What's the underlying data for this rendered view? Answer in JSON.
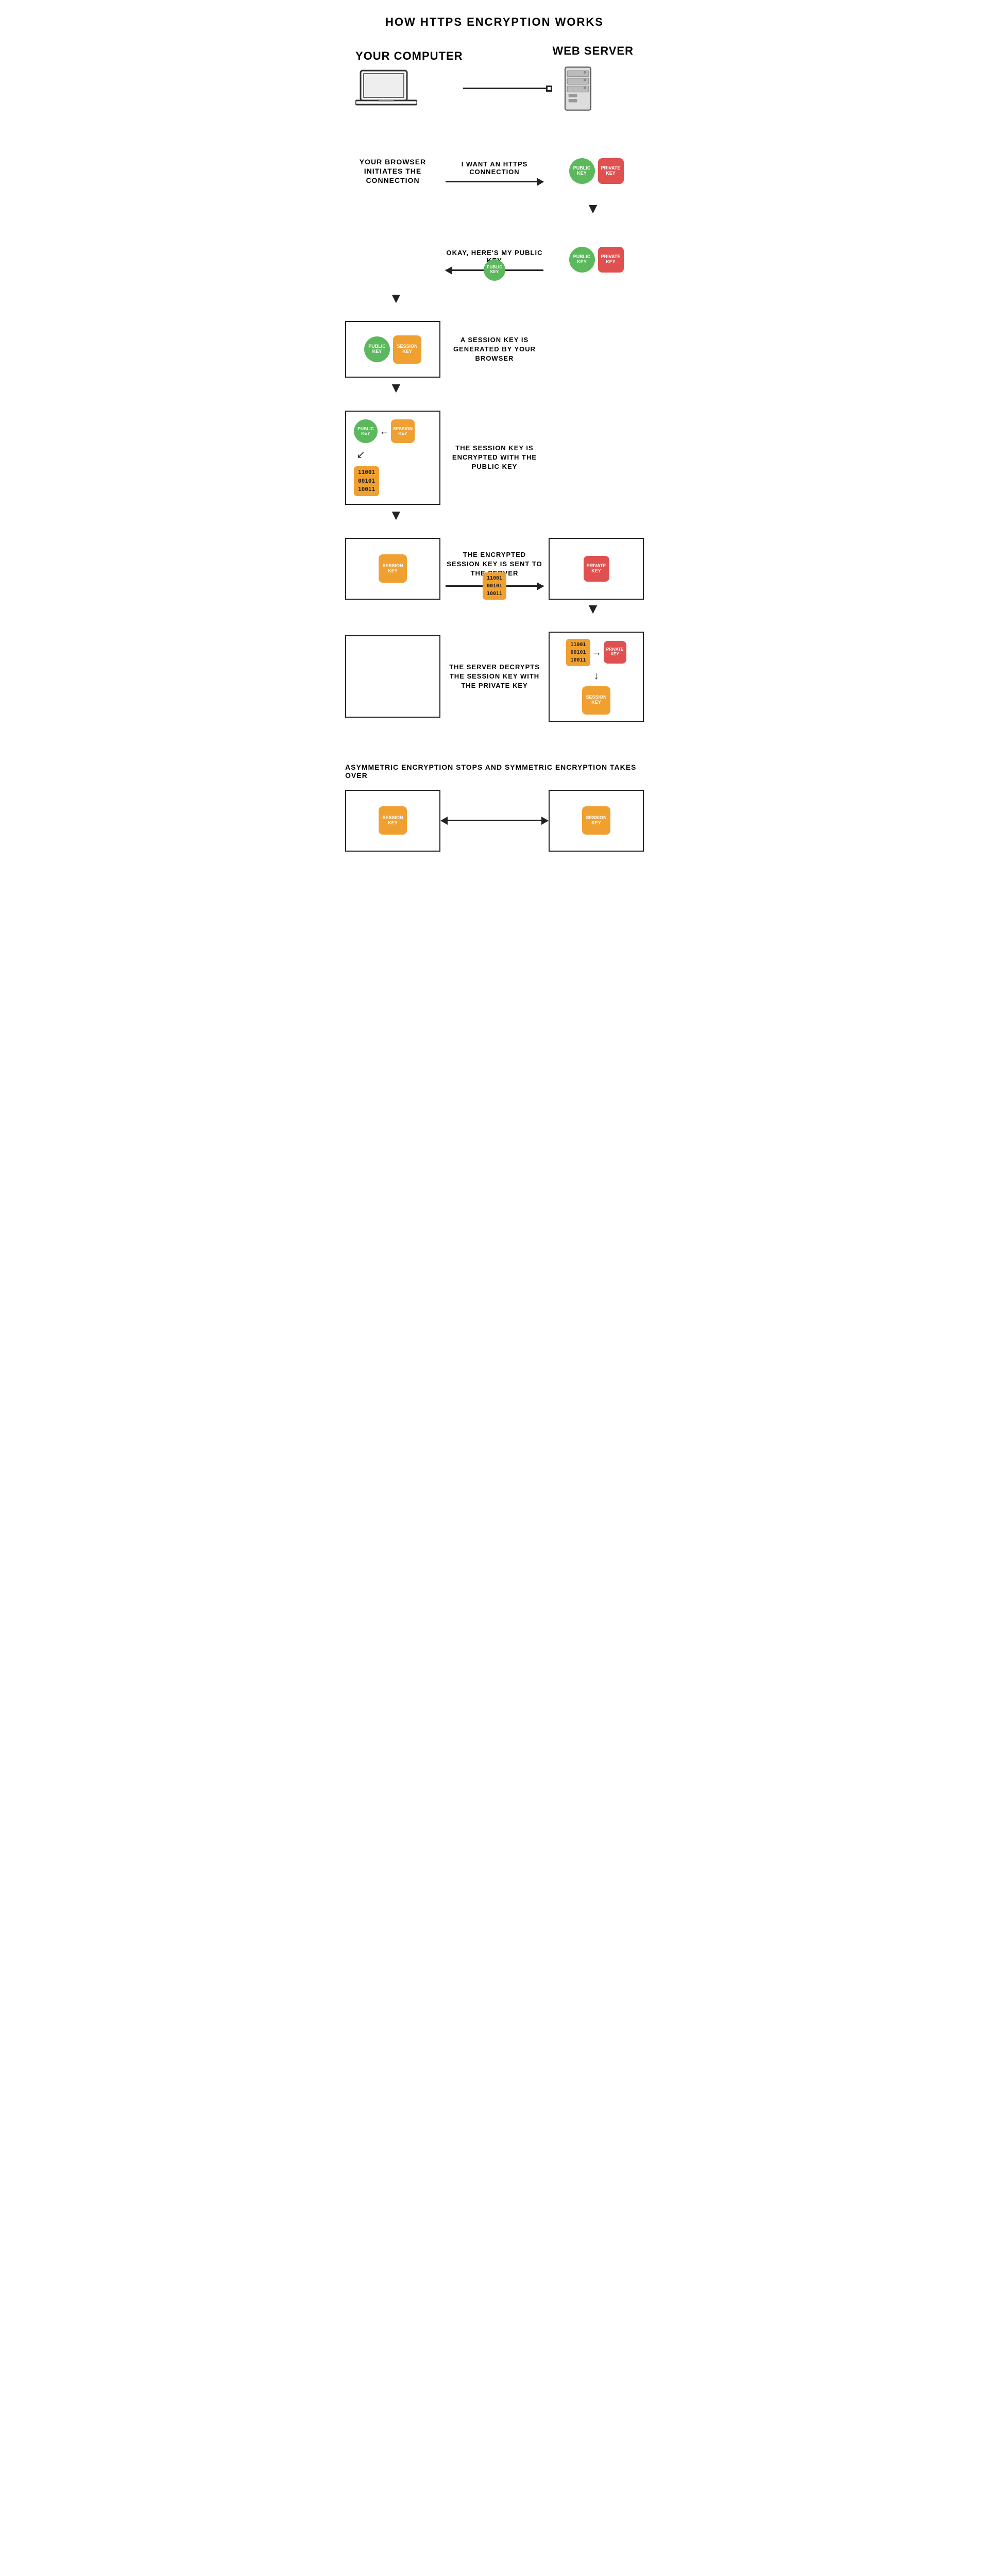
{
  "title": "HOW HTTPS ENCRYPTION WORKS",
  "computer_label": "YOUR COMPUTER",
  "server_label": "WEB SERVER",
  "step1": {
    "left_text": "YOUR BROWSER INITIATES THE CONNECTION",
    "arrow_label": "I WANT AN HTTPS CONNECTION"
  },
  "step2": {
    "arrow_label": "OKAY, HERE'S MY PUBLIC KEY"
  },
  "step3": {
    "label": "A SESSION KEY IS GENERATED BY YOUR BROWSER"
  },
  "step4": {
    "label": "THE SESSION KEY IS ENCRYPTED WITH THE PUBLIC KEY",
    "binary": "11001\n00101\n10011"
  },
  "step5": {
    "label": "THE ENCRYPTED SESSION KEY IS SENT TO THE SERVER",
    "binary": "11001\n00101\n10011"
  },
  "step6": {
    "label": "THE SERVER DECRYPTS THE SESSION KEY WITH THE PRIVATE KEY",
    "binary": "11001\n00101\n10011"
  },
  "bottom_title": "ASYMMETRIC ENCRYPTION STOPS AND SYMMETRIC ENCRYPTION TAKES OVER",
  "public_key_label": "PUBLIC\nKEY",
  "private_key_label": "PRIVATE\nKEY",
  "session_key_label": "SESSION\nKEY"
}
